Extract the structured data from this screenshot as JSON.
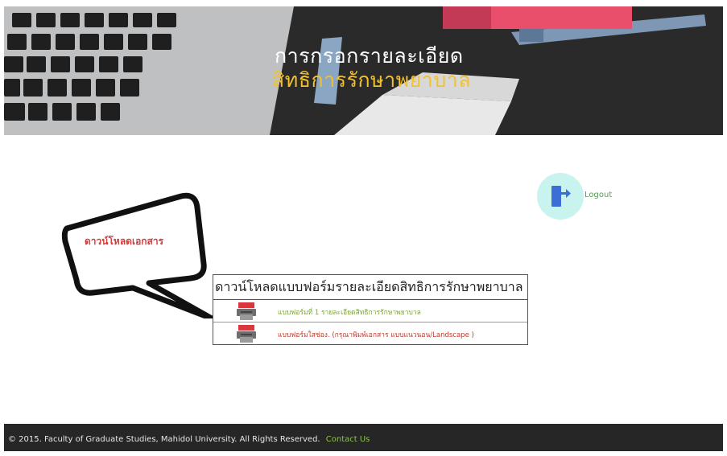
{
  "banner": {
    "title_line1": "การกรอกรายละเอียด",
    "title_line2": "สิทธิการรักษาพยาบาล"
  },
  "logout": {
    "label": "Logout"
  },
  "callout": {
    "text": "ดาวน์โหลดเอกสาร"
  },
  "downloads": {
    "header": "ดาวน์โหลดแบบฟอร์มรายละเอียดสิทธิการรักษาพยาบาล",
    "items": [
      {
        "label": "แบบฟอร์มที่ 1 รายละเอียดสิทธิการรักษาพยาบาล",
        "icon": "pdf-icon",
        "color": "#7aa534"
      },
      {
        "label": "แบบฟอร์มใสช่อง. (กรุณาพิมพ์เอกสาร แบบแนวนอน/Landscape )",
        "icon": "pdf-icon",
        "color": "#c0392b"
      }
    ]
  },
  "footer": {
    "copyright": "© 2015. Faculty of Graduate Studies, Mahidol University. All Rights Reserved.",
    "contact": "Contact Us"
  },
  "colors": {
    "title_accent": "#f2c12e",
    "logout_bg": "#c8f3ee",
    "footer_bg": "#262626",
    "contact_link": "#8bc34a"
  }
}
